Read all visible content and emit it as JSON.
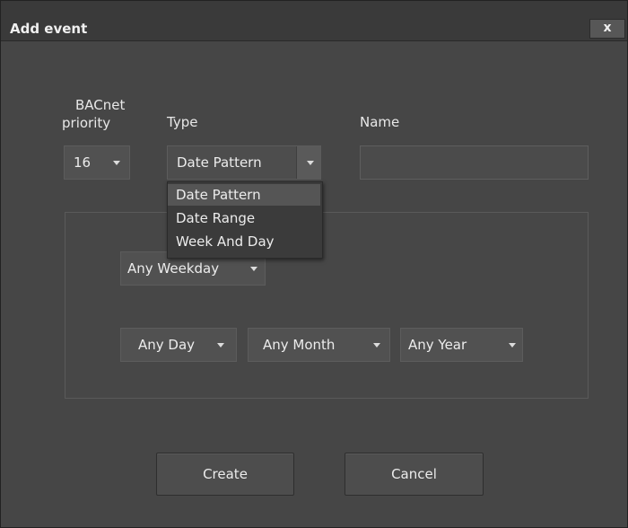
{
  "dialog": {
    "title": "Add event",
    "close_label": "x"
  },
  "fields": {
    "priority_label_line1": "BACnet",
    "priority_label_line2": "priority",
    "priority_value": "16",
    "type_label": "Type",
    "type_value": "Date Pattern",
    "name_label": "Name",
    "name_value": ""
  },
  "type_dropdown": {
    "options": [
      "Date Pattern",
      "Date Range",
      "Week And Day"
    ],
    "selected_index": 0
  },
  "pattern": {
    "weekday": "Any Weekday",
    "day": "Any Day",
    "month": "Any Month",
    "year": "Any Year"
  },
  "buttons": {
    "create": "Create",
    "cancel": "Cancel"
  },
  "icons": {
    "close": "close-icon",
    "dropdown": "chevron-down-icon"
  }
}
